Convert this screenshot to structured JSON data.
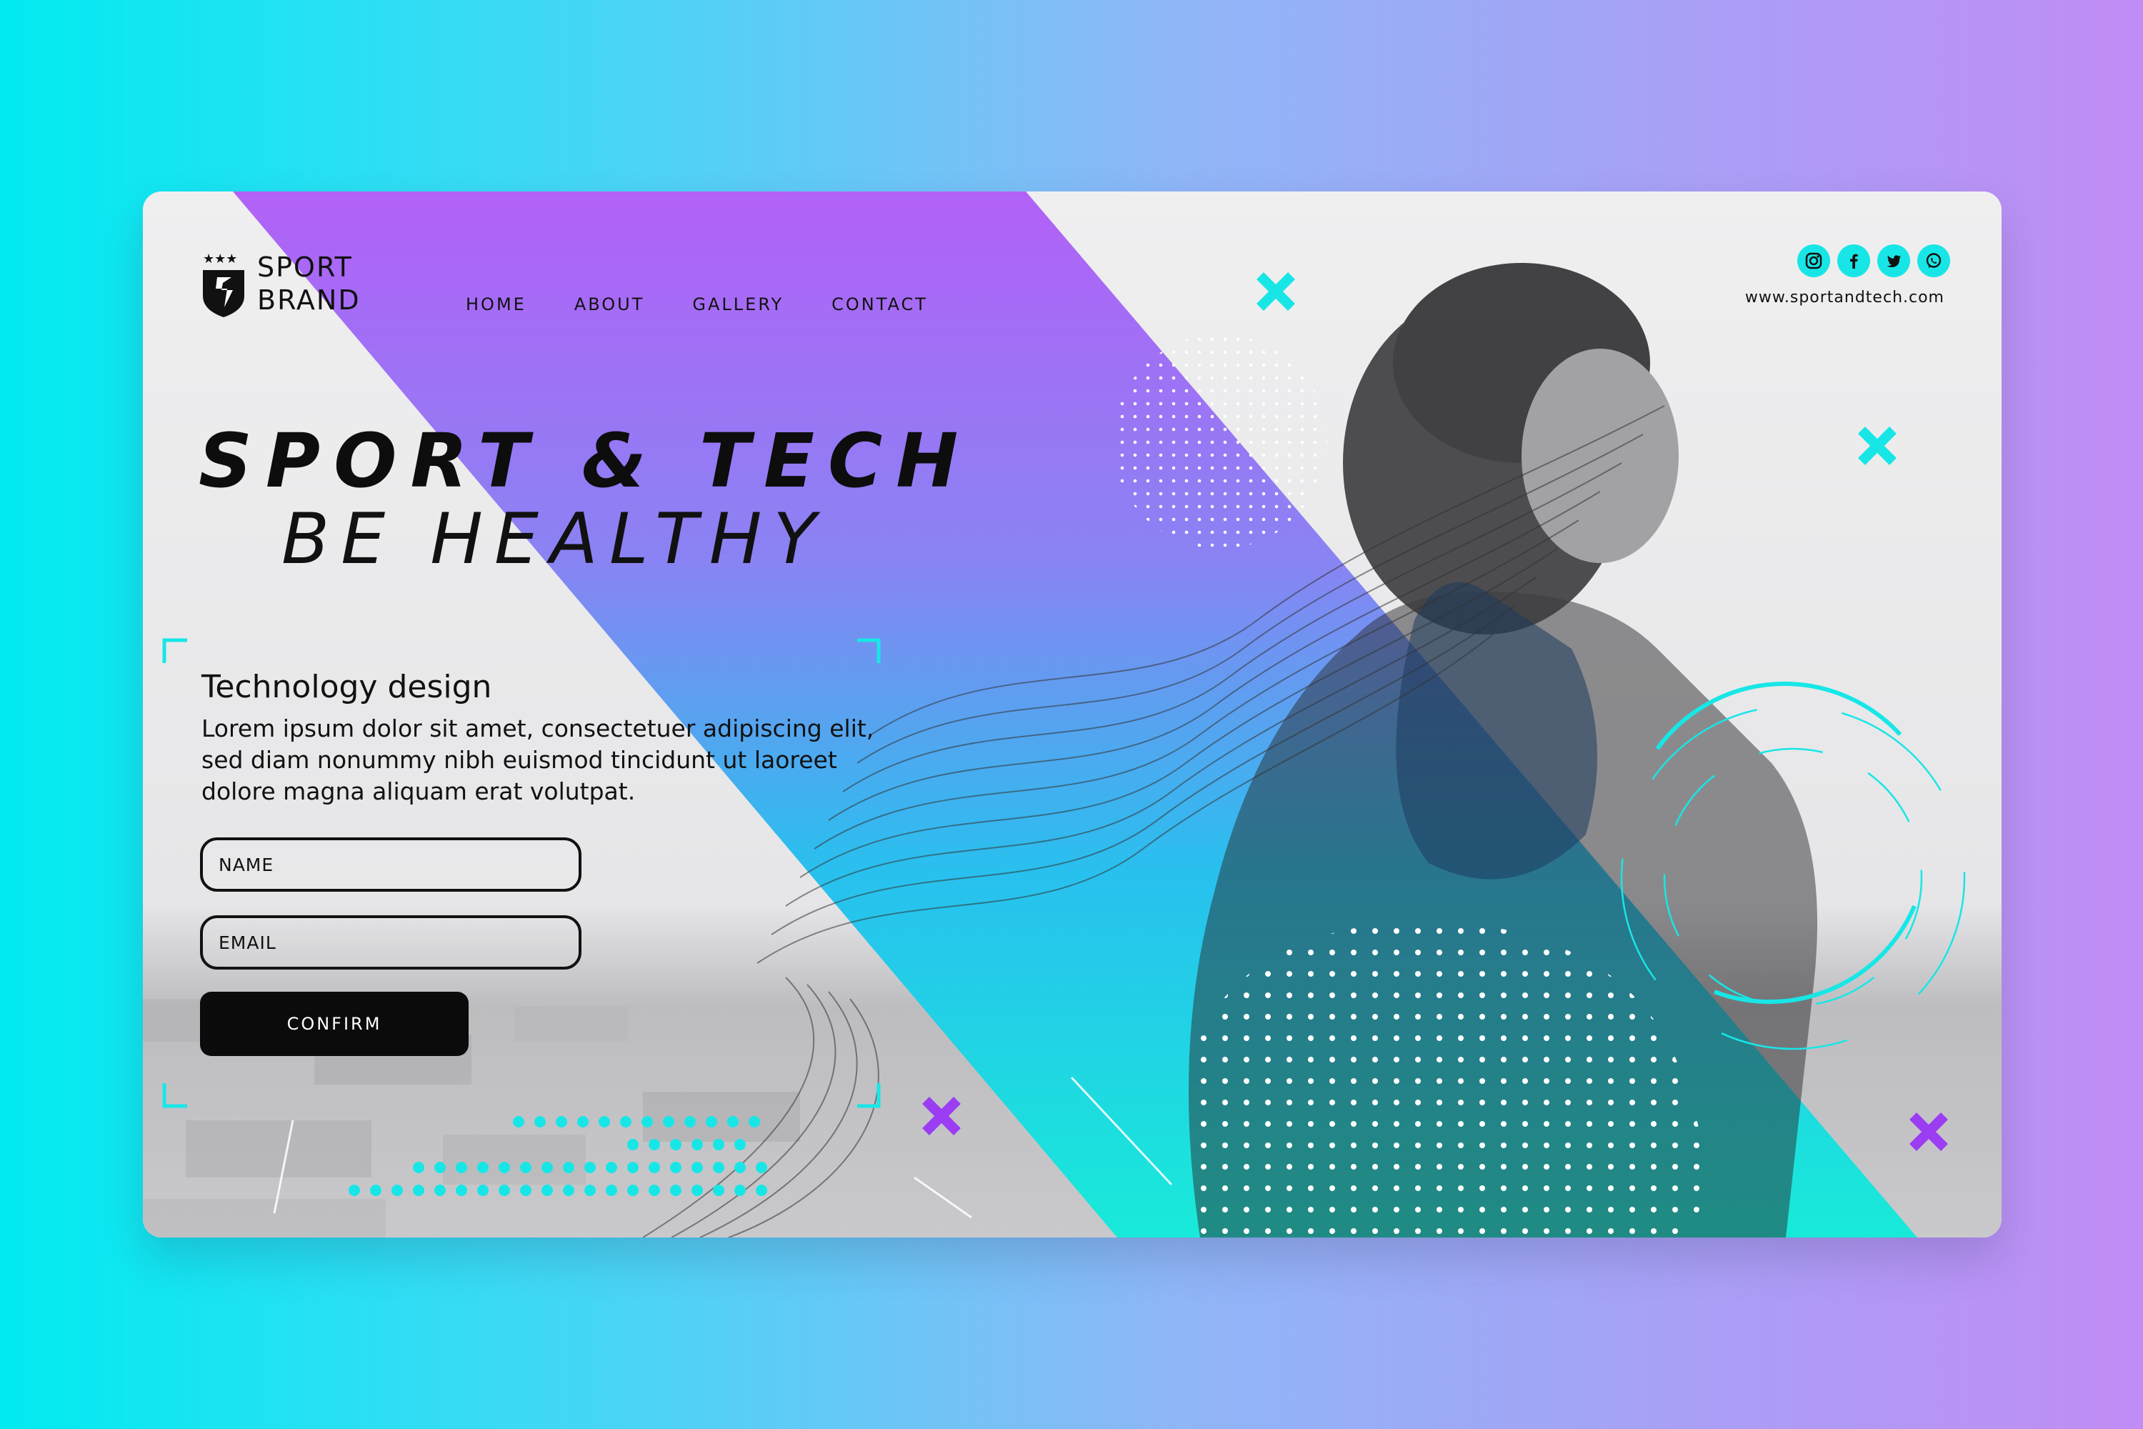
{
  "brand": {
    "line1": "SPORT",
    "line2": "BRAND"
  },
  "nav": [
    "HOME",
    "ABOUT",
    "GALLERY",
    "CONTACT"
  ],
  "hero": {
    "title": "SPORT & TECH",
    "subtitle": "BE HEALTHY"
  },
  "section": {
    "heading": "Technology design",
    "body": [
      "Lorem ipsum dolor sit amet, consectetuer adipiscing elit,",
      "sed diam nonummy nibh euismod tincidunt ut laoreet",
      "dolore magna aliquam erat volutpat."
    ]
  },
  "form": {
    "name_placeholder": "NAME",
    "email_placeholder": "EMAIL",
    "confirm_label": "CONFIRM"
  },
  "social": {
    "icons": [
      "instagram-icon",
      "facebook-icon",
      "twitter-icon",
      "whatsapp-icon"
    ],
    "url": "www.sportandtech.com"
  },
  "colors": {
    "cyan": "#18e6e6",
    "purple": "#a35cf6",
    "accent_purple": "#9b3df2",
    "dark": "#0b0b0b"
  }
}
